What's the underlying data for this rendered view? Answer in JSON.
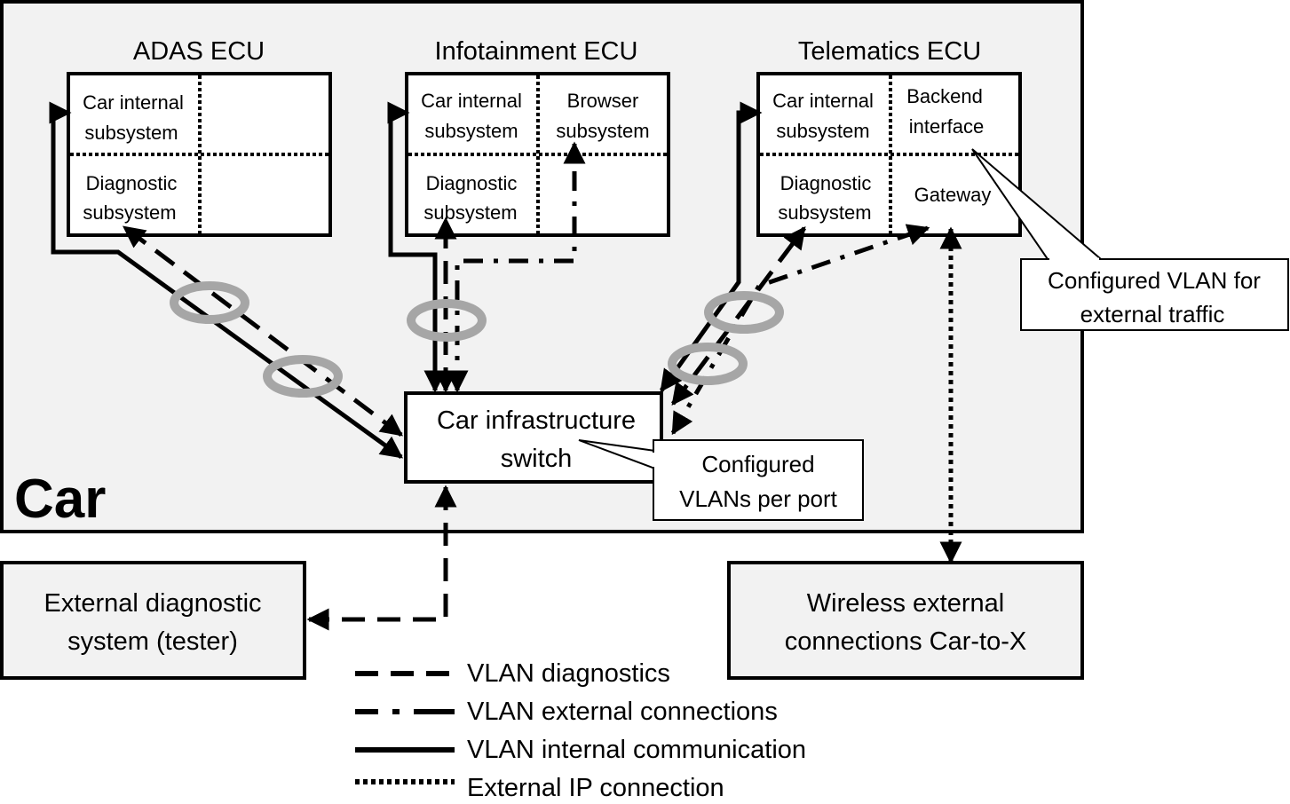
{
  "car": {
    "label": "Car",
    "background": "#f2f2f2"
  },
  "ecus": [
    {
      "title": "ADAS ECU",
      "cells": {
        "top_left": [
          "Car internal",
          "subsystem"
        ],
        "top_right": [],
        "bottom_left": [
          "Diagnostic",
          "subsystem"
        ],
        "bottom_right": []
      }
    },
    {
      "title": "Infotainment ECU",
      "cells": {
        "top_left": [
          "Car internal",
          "subsystem"
        ],
        "top_right": [
          "Browser",
          "subsystem"
        ],
        "bottom_left": [
          "Diagnostic",
          "subsystem"
        ],
        "bottom_right": []
      }
    },
    {
      "title": "Telematics ECU",
      "cells": {
        "top_left": [
          "Car internal",
          "subsystem"
        ],
        "top_right": [
          "Backend",
          "interface"
        ],
        "bottom_left": [
          "Diagnostic",
          "subsystem"
        ],
        "bottom_right": [
          "Gateway"
        ]
      }
    }
  ],
  "switch": {
    "lines": [
      "Car infrastructure",
      "switch"
    ]
  },
  "callouts": {
    "vlans_per_port": [
      "Configured",
      "VLANs per port"
    ],
    "vlan_external": [
      "Configured VLAN for",
      "external traffic"
    ]
  },
  "external": {
    "tester": [
      "External diagnostic",
      "system (tester)"
    ],
    "wireless": [
      "Wireless external",
      "connections Car-to-X"
    ]
  },
  "legend": [
    {
      "style": "dashed",
      "label": "VLAN diagnostics"
    },
    {
      "style": "dashdot",
      "label": "VLAN external connections"
    },
    {
      "style": "solid",
      "label": "VLAN internal communication"
    },
    {
      "style": "dotted",
      "label": "External IP connection"
    }
  ],
  "colors": {
    "line": "#000000",
    "ring": "#a6a6a6",
    "box_fill": "#ffffff",
    "panel_fill": "#f2f2f2"
  }
}
